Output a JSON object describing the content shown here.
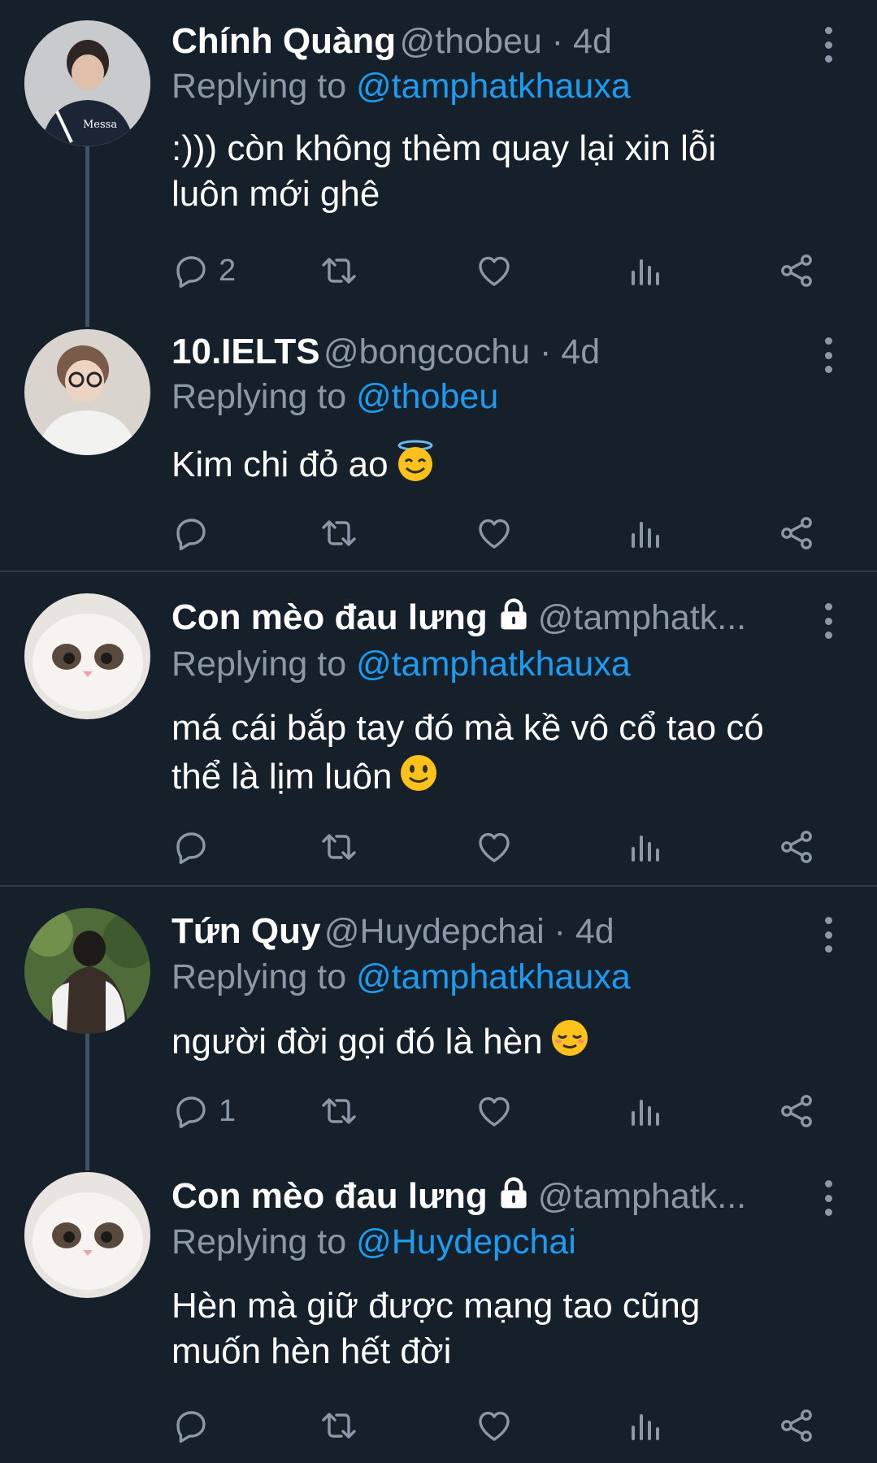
{
  "colors": {
    "background": "#15202b",
    "name": "#ffffff",
    "muted": "#8b98a5",
    "link": "#1d9bf0",
    "divider": "#2f3c4a",
    "thread_line": "#3d5466"
  },
  "tweets": [
    {
      "name": "Chính Quàng",
      "handle": "@thobeu · 4d",
      "replying_label": "Replying to ",
      "replying_to": "@tamphatkhauxa",
      "text_lines": [
        ":))) còn không thèm quay lại xin lỗi",
        "luôn mới ghê"
      ],
      "reply_count": "2",
      "avatar_icon": "avatar-person-photo"
    },
    {
      "name": "10.IELTS",
      "handle": "@bongcochu · 4d",
      "replying_label": "Replying to ",
      "replying_to": "@thobeu",
      "text_lines": [
        "Kim chi đỏ ao"
      ],
      "emoji": "smiling-face-with-halo",
      "reply_count": "",
      "avatar_icon": "avatar-person-photo"
    },
    {
      "name": "Con mèo đau lưng",
      "handle": "@tamphatk...",
      "replying_label": "Replying to ",
      "replying_to": "@tamphatkhauxa",
      "text_lines": [
        "má cái bắp tay đó mà kề vô cổ tao có",
        "thể là lịm luôn"
      ],
      "emoji": "slightly-smiling-face",
      "reply_count": "",
      "protected": true,
      "avatar_icon": "avatar-cat-photo"
    },
    {
      "name": "Tứn Quy",
      "handle": "@Huydepchai · 4d",
      "replying_label": "Replying to ",
      "replying_to": "@tamphatkhauxa",
      "text_lines": [
        "người đời gọi đó là hèn"
      ],
      "emoji": "relieved-face",
      "reply_count": "1",
      "avatar_icon": "avatar-person-photo"
    },
    {
      "name": "Con mèo đau lưng",
      "handle": "@tamphatk...",
      "replying_label": "Replying to ",
      "replying_to": "@Huydepchai",
      "text_lines": [
        "Hèn mà giữ được mạng tao cũng",
        "muốn hèn hết đời"
      ],
      "reply_count": "",
      "protected": true,
      "avatar_icon": "avatar-cat-photo"
    }
  ]
}
